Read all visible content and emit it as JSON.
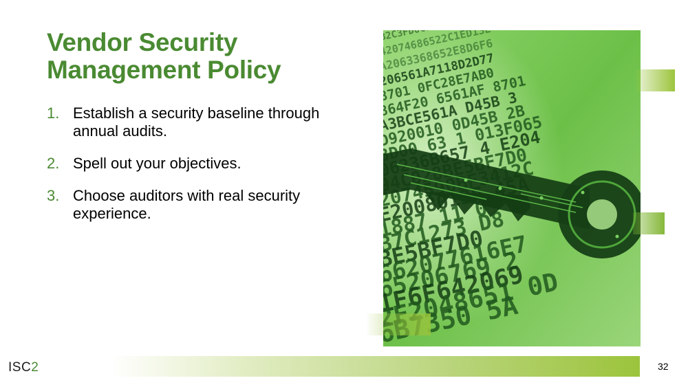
{
  "slide": {
    "title": "Vendor Security Management Policy",
    "bullets": [
      {
        "number": "1.",
        "text": "Establish a security baseline through annual audits."
      },
      {
        "number": "2.",
        "text": "Spell out your objectives."
      },
      {
        "number": "3.",
        "text": "Choose auditors with real security experience."
      }
    ],
    "page_number": "32"
  },
  "logo": {
    "text_main": "ISC",
    "text_accent": "2"
  },
  "image": {
    "icon": "circuit-key-on-hex-code-icon",
    "code_rows": [
      "B2C3FD0C5B8ADE2E",
      "42074686522C1ED13E",
      "A2063368652E8D6F6",
      "206561A7118D2D77",
      "8701 0FC28E7AB0",
      "864F20 6561AF 8701",
      "A3BCE561A D45B 3",
      "D920010 0D45B 2B",
      "3D00 63 1 013F065",
      "06236B657 4 E204",
      "94C028BE5BF7D0",
      "2074590BF3412C",
      "E2008013F 45A",
      "1887 11 0",
      "B7C1273 D8",
      "BE5BF7D0",
      "662077616E7",
      "65206769 2",
      "1F6F642069",
      "2F2048651 0D",
      "6B7350 5A"
    ]
  },
  "colors": {
    "title_green": "#4a8a32",
    "accent_lime": "#9cc43c",
    "text_black": "#000000"
  }
}
